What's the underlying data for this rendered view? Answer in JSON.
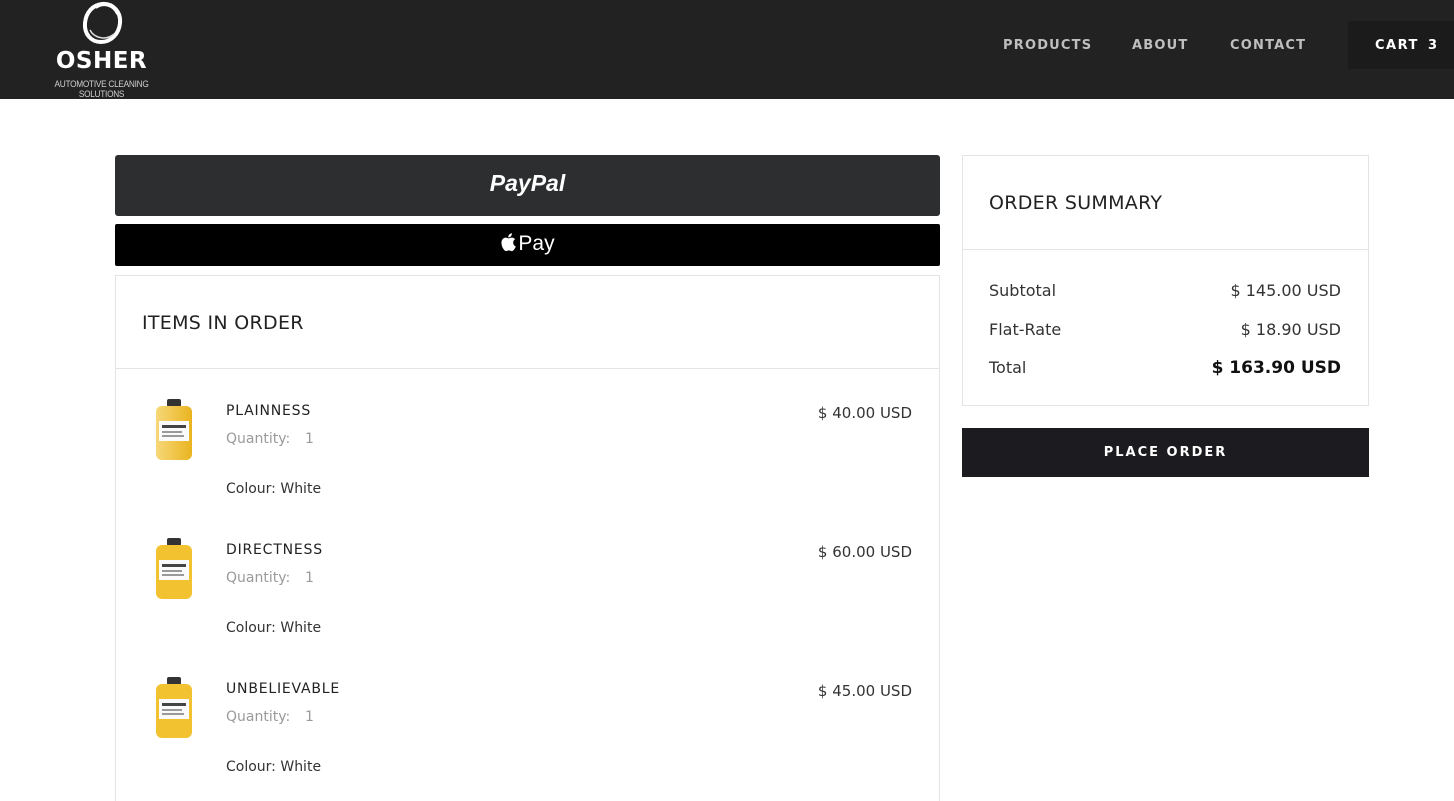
{
  "brand": {
    "name": "OSHER",
    "tagline": "AUTOMOTIVE CLEANING SOLUTIONS",
    "logo_icon": "circle-brush-logo"
  },
  "nav": {
    "products": "PRODUCTS",
    "about": "ABOUT",
    "contact": "CONTACT",
    "cart_label": "CART",
    "cart_count": "3"
  },
  "payments": {
    "paypal_label": "PayPal",
    "applepay_label": "Pay",
    "applepay_icon": "apple-icon"
  },
  "items_panel": {
    "title": "ITEMS IN ORDER",
    "quantity_label": "Quantity:",
    "items": [
      {
        "name": "PLAINNESS",
        "quantity": "1",
        "colour": "Colour: White",
        "price": "$ 40.00 USD"
      },
      {
        "name": "DIRECTNESS",
        "quantity": "1",
        "colour": "Colour: White",
        "price": "$ 60.00 USD"
      },
      {
        "name": "UNBELIEVABLE",
        "quantity": "1",
        "colour": "Colour: White",
        "price": "$ 45.00 USD"
      }
    ]
  },
  "summary": {
    "title": "ORDER SUMMARY",
    "subtotal_label": "Subtotal",
    "subtotal_value": "$ 145.00 USD",
    "shipping_label": "Flat-Rate",
    "shipping_value": "$ 18.90 USD",
    "total_label": "Total",
    "total_value": "$ 163.90 USD"
  },
  "place_order_label": "PLACE ORDER",
  "colors": {
    "header_bg": "#222222",
    "paypal_bg": "#2c2e2f",
    "applepay_bg": "#000000",
    "button_dark": "#1c1c20",
    "product_yellow": "#f2c230"
  }
}
